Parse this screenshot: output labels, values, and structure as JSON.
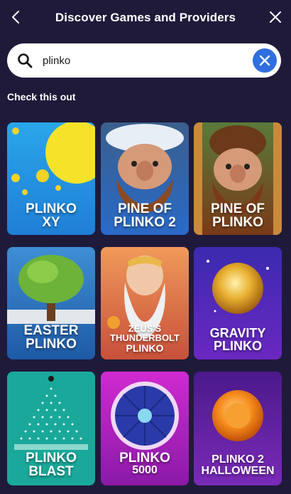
{
  "header": {
    "title": "Discover Games and Providers",
    "back_icon": "chevron-left-icon",
    "close_icon": "close-icon"
  },
  "search": {
    "value": "plinko",
    "icon": "search-icon",
    "clear_icon": "close-icon",
    "clear_color": "#2f6fe0"
  },
  "section": {
    "title": "Check this out"
  },
  "games": [
    {
      "line1": "PLINKO",
      "line2": "XY",
      "bg": "#2a9be6"
    },
    {
      "line1": "PINE OF",
      "line2": "PLINKO 2",
      "bg": "#2a6fc4"
    },
    {
      "line1": "PINE OF",
      "line2": "PLINKO",
      "bg": "#7a3b1a"
    },
    {
      "line1": "EASTER",
      "line2": "PLINKO",
      "bg": "#3f8ed4"
    },
    {
      "line1": "ZEUS'S THUNDERBOLT",
      "line2": "PLINKO",
      "bg": "#e0763a"
    },
    {
      "line1": "GRAVITY",
      "line2": "PLINKO",
      "bg": "#5a2ab8"
    },
    {
      "line1": "PLINKO",
      "line2": "BLAST",
      "bg": "#1aa89a"
    },
    {
      "line1": "PLINKO",
      "line2": "5000",
      "bg": "#b01fb8"
    },
    {
      "line1": "PLINKO 2",
      "line2": "HALLOWEEN",
      "bg": "#6a2ab0"
    }
  ],
  "colors": {
    "background": "#1f1a3a",
    "accent": "#2f6fe0"
  }
}
